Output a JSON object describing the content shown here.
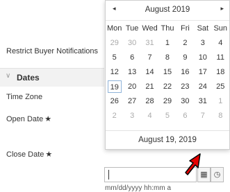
{
  "form": {
    "restrict_label": "Restrict Buyer Notifications",
    "section_title": "Dates",
    "timezone_label": "Time Zone",
    "open_label": "Open Date",
    "close_label": "Close Date",
    "required_mark": "★",
    "close_value": "",
    "close_hint": "mm/dd/yyyy hh:mm a"
  },
  "datepicker": {
    "prev": "◂",
    "next": "▸",
    "month_label": "August 2019",
    "weekdays": [
      "Mon",
      "Tue",
      "Wed",
      "Thu",
      "Fri",
      "Sat",
      "Sun"
    ],
    "weeks": [
      [
        "29",
        "30",
        "31",
        "1",
        "2",
        "3",
        "4"
      ],
      [
        "5",
        "6",
        "7",
        "8",
        "9",
        "10",
        "11"
      ],
      [
        "12",
        "13",
        "14",
        "15",
        "16",
        "17",
        "18"
      ],
      [
        "19",
        "20",
        "21",
        "22",
        "23",
        "24",
        "25"
      ],
      [
        "26",
        "27",
        "28",
        "29",
        "30",
        "31",
        "1"
      ],
      [
        "2",
        "3",
        "4",
        "5",
        "6",
        "7",
        "8"
      ]
    ],
    "footer": "August 19, 2019"
  },
  "icons": {
    "calendar": "▦",
    "clock": "◷"
  },
  "colors": {
    "arrow": "#e60000",
    "today_border": "#8fb3d9"
  }
}
